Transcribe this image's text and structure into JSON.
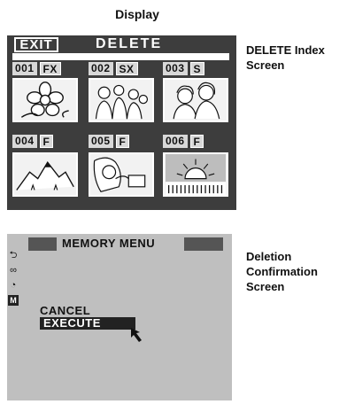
{
  "heading": "Display",
  "delete_screen": {
    "exit_label": "EXIT",
    "title": "DELETE",
    "thumbnails": [
      {
        "number": "001",
        "quality": "FX",
        "image": "flower"
      },
      {
        "number": "002",
        "quality": "SX",
        "image": "group of people"
      },
      {
        "number": "003",
        "quality": "S",
        "image": "two women"
      },
      {
        "number": "004",
        "quality": "F",
        "image": "mountains"
      },
      {
        "number": "005",
        "quality": "F",
        "image": "woman on phone"
      },
      {
        "number": "006",
        "quality": "F",
        "image": "sunset over sea"
      }
    ],
    "caption": "DELETE Index Screen"
  },
  "memory_screen": {
    "title": "MEMORY  MENU",
    "cancel": "CANCEL",
    "execute": "EXECUTE",
    "side_icons": [
      "return-icon",
      "link-icon",
      "timer-icon",
      "m-icon"
    ],
    "side_m": "M",
    "caption": "Deletion Confirmation Screen"
  }
}
